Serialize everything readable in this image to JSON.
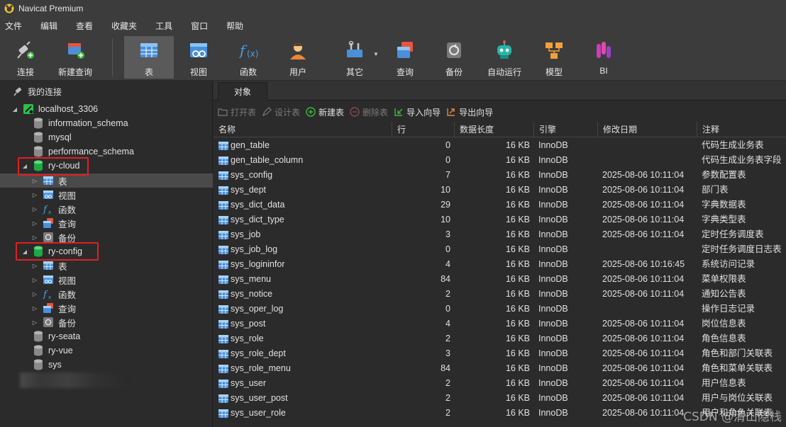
{
  "window": {
    "title": "Navicat Premium"
  },
  "menu": [
    "文件",
    "编辑",
    "查看",
    "收藏夹",
    "工具",
    "窗口",
    "帮助"
  ],
  "toolbar": {
    "connect": "连接",
    "new_query": "新建查询",
    "table": "表",
    "view": "视图",
    "function": "函数",
    "user": "用户",
    "other": "其它",
    "query": "查询",
    "backup": "备份",
    "automation": "自动运行",
    "model": "模型",
    "bi": "BI"
  },
  "sidebar": {
    "header": "我的连接",
    "connection": "localhost_3306",
    "databases": [
      "information_schema",
      "mysql",
      "performance_schema",
      "ry-cloud"
    ],
    "ry_cloud_children": [
      "表",
      "视图",
      "函数",
      "查询",
      "备份"
    ],
    "ry_config": "ry-config",
    "ry_config_children": [
      "表",
      "视图",
      "函数",
      "查询",
      "备份"
    ],
    "more_databases": [
      "ry-seata",
      "ry-vue",
      "sys"
    ]
  },
  "main": {
    "tab": "对象",
    "actions": {
      "open": "打开表",
      "design": "设计表",
      "new": "新建表",
      "delete": "删除表",
      "import": "导入向导",
      "export": "导出向导"
    },
    "columns": [
      "名称",
      "行",
      "数据长度",
      "引擎",
      "修改日期",
      "注释"
    ],
    "rows": [
      {
        "name": "gen_table",
        "rows": "0",
        "size": "16 KB",
        "engine": "InnoDB",
        "date": "",
        "comment": "代码生成业务表"
      },
      {
        "name": "gen_table_column",
        "rows": "0",
        "size": "16 KB",
        "engine": "InnoDB",
        "date": "",
        "comment": "代码生成业务表字段"
      },
      {
        "name": "sys_config",
        "rows": "7",
        "size": "16 KB",
        "engine": "InnoDB",
        "date": "2025-08-06 10:11:04",
        "comment": "参数配置表"
      },
      {
        "name": "sys_dept",
        "rows": "10",
        "size": "16 KB",
        "engine": "InnoDB",
        "date": "2025-08-06 10:11:04",
        "comment": "部门表"
      },
      {
        "name": "sys_dict_data",
        "rows": "29",
        "size": "16 KB",
        "engine": "InnoDB",
        "date": "2025-08-06 10:11:04",
        "comment": "字典数据表"
      },
      {
        "name": "sys_dict_type",
        "rows": "10",
        "size": "16 KB",
        "engine": "InnoDB",
        "date": "2025-08-06 10:11:04",
        "comment": "字典类型表"
      },
      {
        "name": "sys_job",
        "rows": "3",
        "size": "16 KB",
        "engine": "InnoDB",
        "date": "2025-08-06 10:11:04",
        "comment": "定时任务调度表"
      },
      {
        "name": "sys_job_log",
        "rows": "0",
        "size": "16 KB",
        "engine": "InnoDB",
        "date": "",
        "comment": "定时任务调度日志表"
      },
      {
        "name": "sys_logininfor",
        "rows": "4",
        "size": "16 KB",
        "engine": "InnoDB",
        "date": "2025-08-06 10:16:45",
        "comment": "系统访问记录"
      },
      {
        "name": "sys_menu",
        "rows": "84",
        "size": "16 KB",
        "engine": "InnoDB",
        "date": "2025-08-06 10:11:04",
        "comment": "菜单权限表"
      },
      {
        "name": "sys_notice",
        "rows": "2",
        "size": "16 KB",
        "engine": "InnoDB",
        "date": "2025-08-06 10:11:04",
        "comment": "通知公告表"
      },
      {
        "name": "sys_oper_log",
        "rows": "0",
        "size": "16 KB",
        "engine": "InnoDB",
        "date": "",
        "comment": "操作日志记录"
      },
      {
        "name": "sys_post",
        "rows": "4",
        "size": "16 KB",
        "engine": "InnoDB",
        "date": "2025-08-06 10:11:04",
        "comment": "岗位信息表"
      },
      {
        "name": "sys_role",
        "rows": "2",
        "size": "16 KB",
        "engine": "InnoDB",
        "date": "2025-08-06 10:11:04",
        "comment": "角色信息表"
      },
      {
        "name": "sys_role_dept",
        "rows": "3",
        "size": "16 KB",
        "engine": "InnoDB",
        "date": "2025-08-06 10:11:04",
        "comment": "角色和部门关联表"
      },
      {
        "name": "sys_role_menu",
        "rows": "84",
        "size": "16 KB",
        "engine": "InnoDB",
        "date": "2025-08-06 10:11:04",
        "comment": "角色和菜单关联表"
      },
      {
        "name": "sys_user",
        "rows": "2",
        "size": "16 KB",
        "engine": "InnoDB",
        "date": "2025-08-06 10:11:04",
        "comment": "用户信息表"
      },
      {
        "name": "sys_user_post",
        "rows": "2",
        "size": "16 KB",
        "engine": "InnoDB",
        "date": "2025-08-06 10:11:04",
        "comment": "用户与岗位关联表"
      },
      {
        "name": "sys_user_role",
        "rows": "2",
        "size": "16 KB",
        "engine": "InnoDB",
        "date": "2025-08-06 10:11:04",
        "comment": "用户和角色关联表"
      }
    ]
  },
  "watermark": "CSDN @清山隐栈",
  "colors": {
    "highlight_box": "#e02020",
    "db_green": "#27c24c",
    "table_blue": "#4a90d9"
  }
}
